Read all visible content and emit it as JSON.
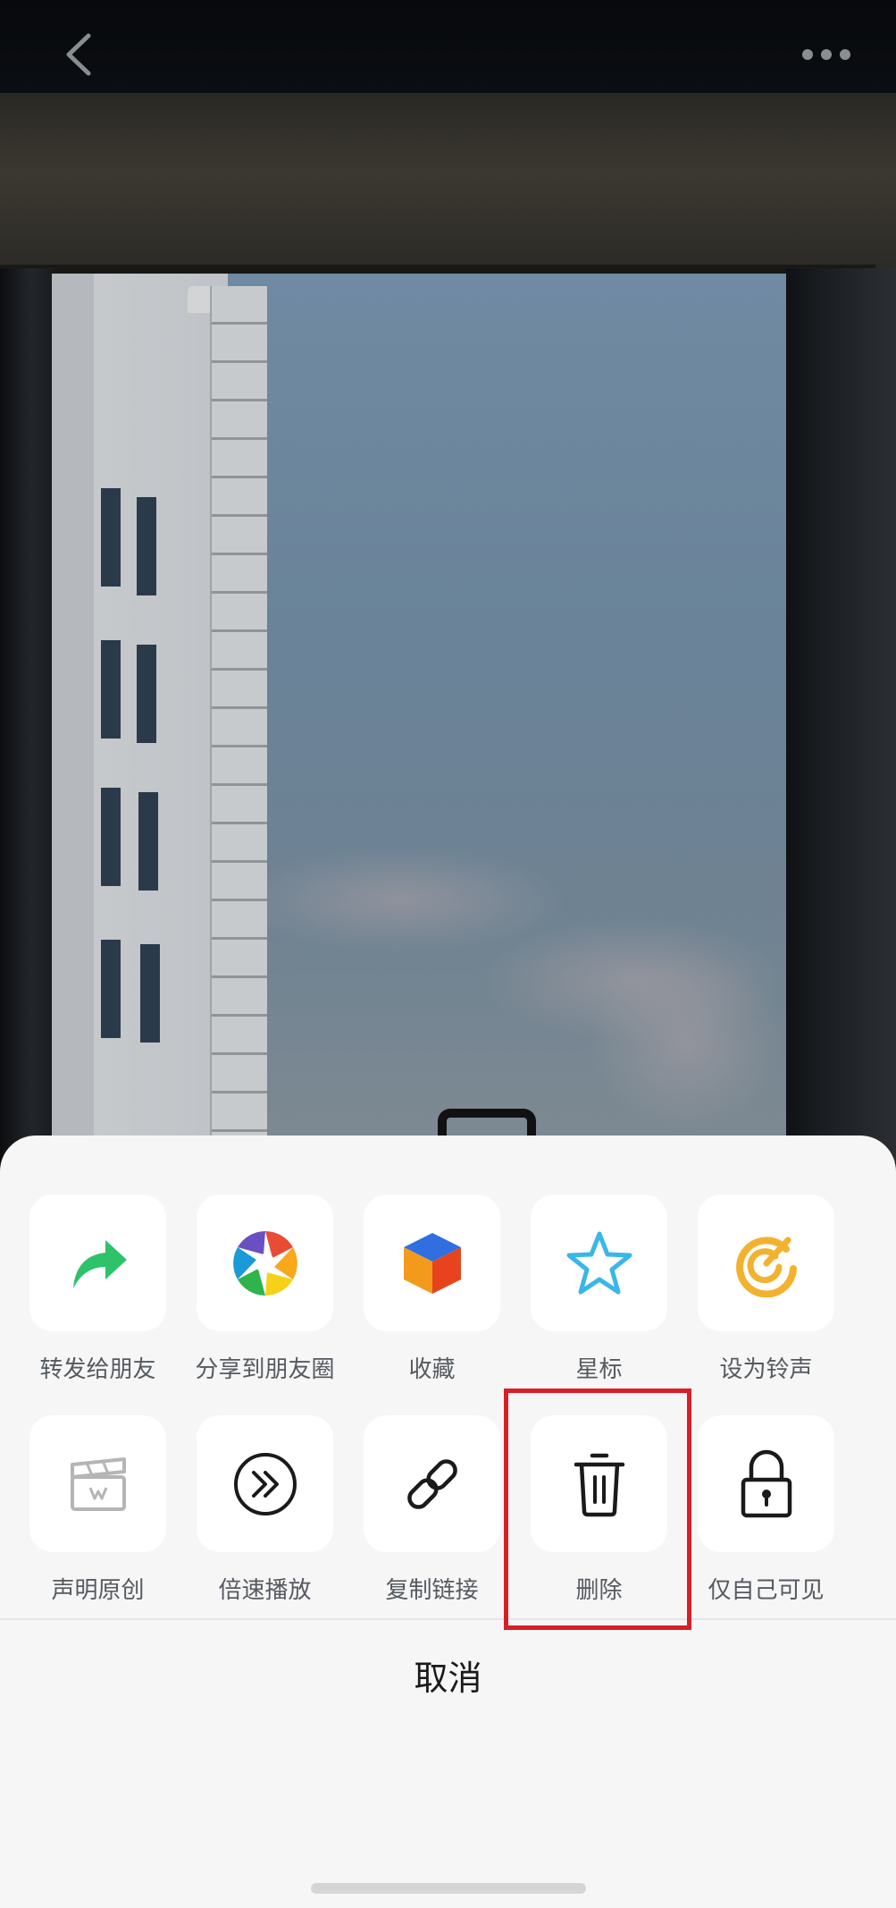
{
  "nav": {
    "back_icon": "chevron-left-icon",
    "more_icon": "more-dots-icon"
  },
  "actions_row1": [
    {
      "label": "转发给朋友",
      "icon": "share-arrow-icon",
      "color": "#2ec26a"
    },
    {
      "label": "分享到朋友圈",
      "icon": "moments-aperture-icon",
      "color": "#e94b35"
    },
    {
      "label": "收藏",
      "icon": "favorite-cube-icon",
      "color": "#f39a1d"
    },
    {
      "label": "星标",
      "icon": "star-icon",
      "color": "#39b6ea"
    },
    {
      "label": "设为铃声",
      "icon": "ringtone-icon",
      "color": "#f2b230"
    }
  ],
  "actions_row2": [
    {
      "label": "声明原创",
      "icon": "clapperboard-icon",
      "color": "#b5b5b5"
    },
    {
      "label": "倍速播放",
      "icon": "playback-speed-icon",
      "color": "#1a1a1a"
    },
    {
      "label": "复制链接",
      "icon": "link-icon",
      "color": "#1a1a1a"
    },
    {
      "label": "删除",
      "icon": "trash-icon",
      "color": "#1a1a1a"
    },
    {
      "label": "仅自己可见",
      "icon": "lock-icon",
      "color": "#1a1a1a"
    }
  ],
  "cancel_label": "取消",
  "highlight_color": "#d81f26"
}
